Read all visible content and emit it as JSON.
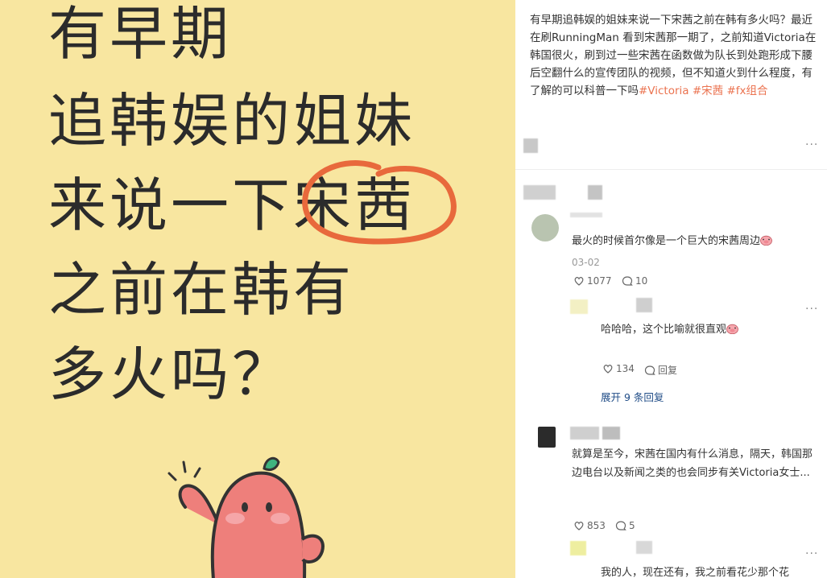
{
  "image": {
    "lines": [
      "有早期",
      "追韩娱的姐妹",
      "来说一下宋茜",
      "之前在韩有",
      "多火吗？"
    ],
    "background_color": "#f8e6a0",
    "circle_color": "#e8693c"
  },
  "post": {
    "text_before_tags": "有早期追韩娱的姐妹来说一下宋茜之前在韩有多火吗？最近在刷RunningMan 看到宋茜那一期了，之前知道Victoria在韩国很火，刷到过一些宋茜在函数做为队长到处跑形成下腰后空翻什么的宣传团队的视频，但不知道火到什么程度，有了解的可以科普一下吗",
    "tags": [
      "#Victoria",
      "#宋茜",
      "#fx组合"
    ],
    "more_icon": "more-dots-icon"
  },
  "comments": [
    {
      "text": "最火的时候首尔像是一个巨大的宋茜周边",
      "date": "03-02",
      "likes": "1077",
      "replies": "10",
      "reply": {
        "text": "哈哈哈，这个比喻就很直观",
        "likes": "134",
        "reply_label": "回复"
      },
      "expand_label": "展开 9 条回复"
    },
    {
      "text": "就算是至今，宋茜在国内有什么消息，隔天，韩国那边电台以及新闻之类的也会同步有关Victoria女士...",
      "likes": "853",
      "replies": "5",
      "reply": {
        "text": "我的人，现在还有，我之前看花少那个花"
      }
    }
  ],
  "icons": {
    "like": "heart-outline-icon",
    "comment": "comment-bubble-icon",
    "more": "more-dots-icon",
    "emoji": "pig-face-emoji-icon"
  }
}
